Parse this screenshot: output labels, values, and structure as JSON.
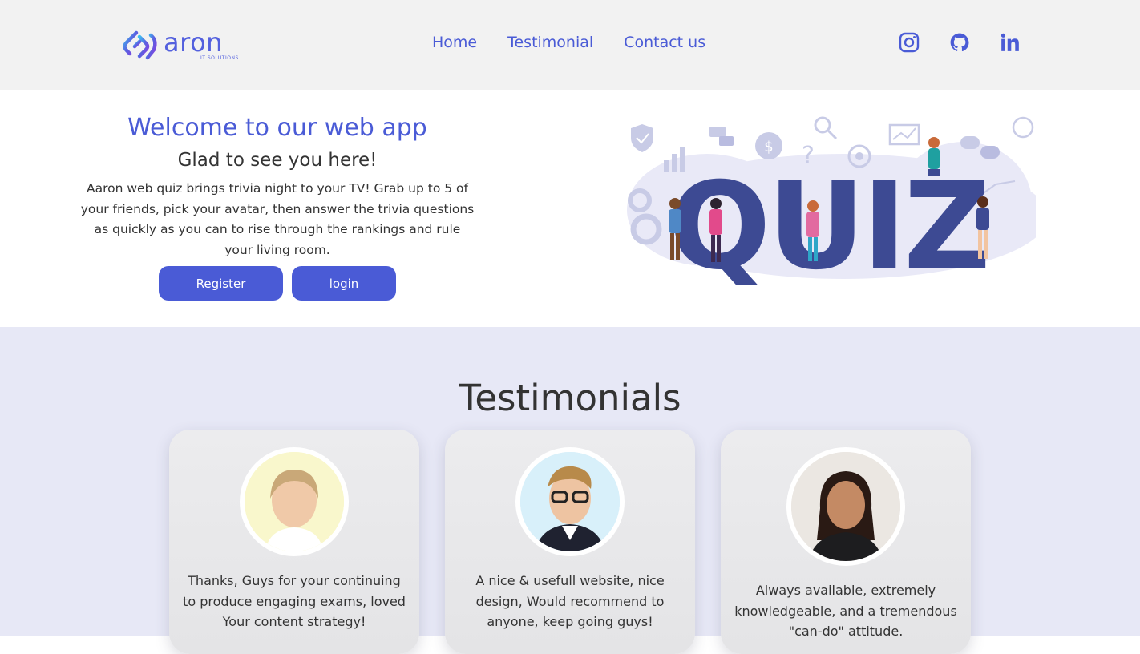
{
  "brand": {
    "name": "aron",
    "tagline": "IT SOLUTIONS"
  },
  "nav": {
    "items": [
      "Home",
      "Testimonial",
      "Contact us"
    ]
  },
  "social": {
    "icons": [
      "instagram-icon",
      "github-icon",
      "linkedin-icon"
    ]
  },
  "hero": {
    "title": "Welcome to our web app",
    "subtitle": "Glad to see you here!",
    "description": "Aaron web quiz brings trivia night to your TV! Grab up to 5 of your friends, pick your avatar, then answer the trivia questions as quickly as you can to rise through the rankings and rule your living room.",
    "register_label": "Register",
    "login_label": "login",
    "illustration_word": "QUIZ"
  },
  "testimonials": {
    "title": "Testimonials",
    "items": [
      {
        "quote": "Thanks, Guys for your continuing to produce engaging exams, loved Your content strategy!"
      },
      {
        "quote": "A nice & usefull website, nice design, Would recommend to anyone, keep going guys!"
      },
      {
        "quote": "Always available, extremely knowledgeable, and a tremendous \"can-do\" attitude."
      }
    ]
  },
  "colors": {
    "accent": "#4a5bd6",
    "header_bg": "#f2f2f2",
    "testimonial_bg": "#e7e8f6",
    "quiz_letters": "#3d4a93"
  }
}
